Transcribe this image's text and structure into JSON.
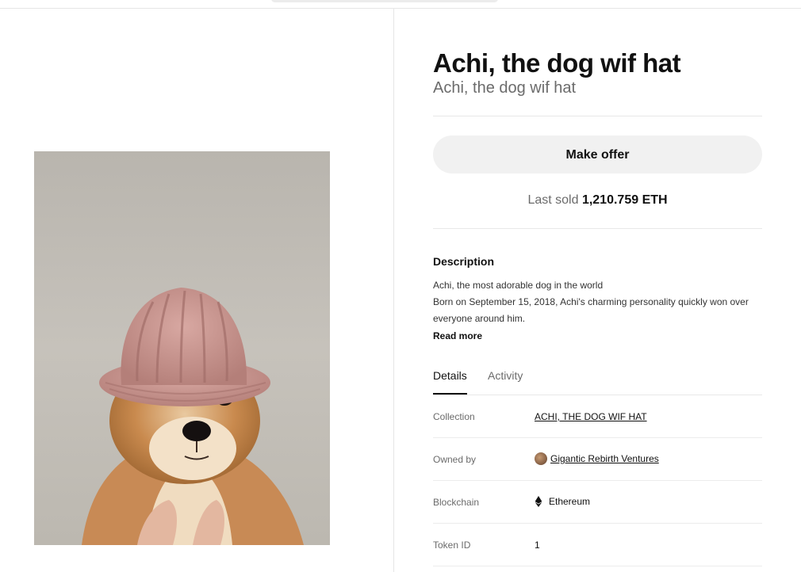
{
  "item": {
    "title": "Achi, the dog wif hat",
    "subtitle": "Achi, the dog wif hat"
  },
  "actions": {
    "make_offer_label": "Make offer"
  },
  "last_sold": {
    "prefix": "Last sold",
    "price": "1,210.759 ETH"
  },
  "description": {
    "heading": "Description",
    "line1": "Achi, the most adorable dog in the world",
    "line2": "Born on September 15, 2018, Achi's charming personality quickly won over everyone around him.",
    "read_more": "Read more"
  },
  "tabs": [
    {
      "label": "Details",
      "active": true
    },
    {
      "label": "Activity",
      "active": false
    }
  ],
  "details": {
    "collection": {
      "label": "Collection",
      "value": "ACHI, THE DOG WIF HAT"
    },
    "owner": {
      "label": "Owned by",
      "value": "Gigantic Rebirth Ventures"
    },
    "blockchain": {
      "label": "Blockchain",
      "value": "Ethereum",
      "icon": "ethereum-icon"
    },
    "token_id": {
      "label": "Token ID",
      "value": "1"
    }
  },
  "colors": {
    "accent": "#111111",
    "muted": "#6b6b6b",
    "button_bg": "#f1f1f1"
  }
}
